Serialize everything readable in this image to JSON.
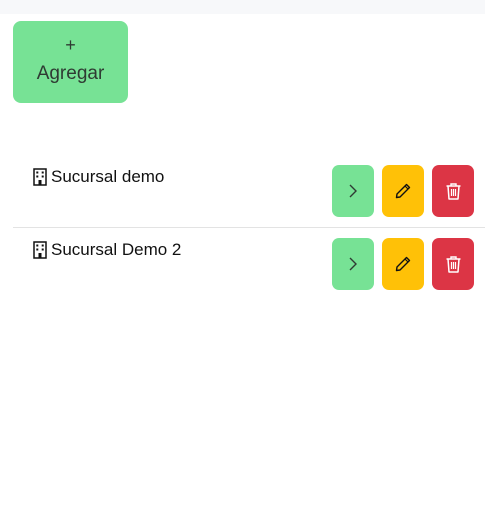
{
  "toolbar": {
    "add_plus": "+",
    "add_label": "Agregar"
  },
  "colors": {
    "add_button": "#77e295",
    "open_button": "#77e295",
    "edit_button": "#ffc107",
    "delete_button": "#dc3545"
  },
  "branches": [
    {
      "name": "Sucursal demo",
      "icon": "building-icon"
    },
    {
      "name": "Sucursal Demo 2",
      "icon": "building-icon"
    }
  ],
  "row_actions": [
    "chevron-right-icon",
    "pencil-icon",
    "trash-icon"
  ]
}
